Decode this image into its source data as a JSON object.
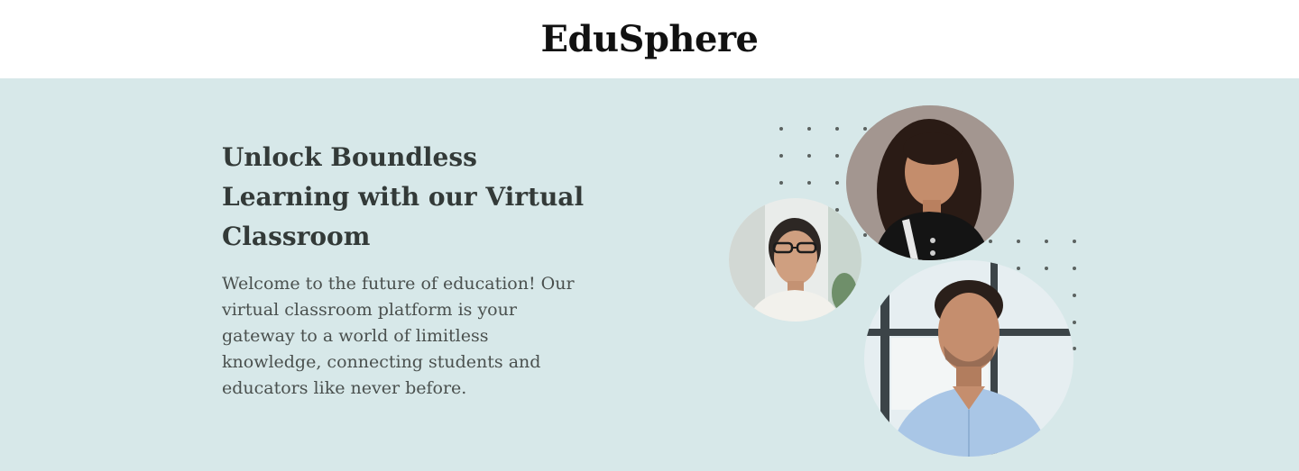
{
  "header": {
    "brand": "EduSphere"
  },
  "hero": {
    "title": "Unlock Boundless Learning with our Virtual Classroom",
    "description": "Welcome to the future of education! Our virtual classroom platform is your gateway to a world of limitless knowledge, connecting students and educators like never before.",
    "images": [
      {
        "name": "student-woman-long-hair-photo"
      },
      {
        "name": "student-woman-glasses-photo"
      },
      {
        "name": "educator-man-blue-shirt-photo"
      }
    ]
  },
  "colors": {
    "hero_background": "#d7e8e9",
    "heading_text": "#333a38",
    "body_text": "#4a504e",
    "dot_pattern": "#5b6260"
  }
}
